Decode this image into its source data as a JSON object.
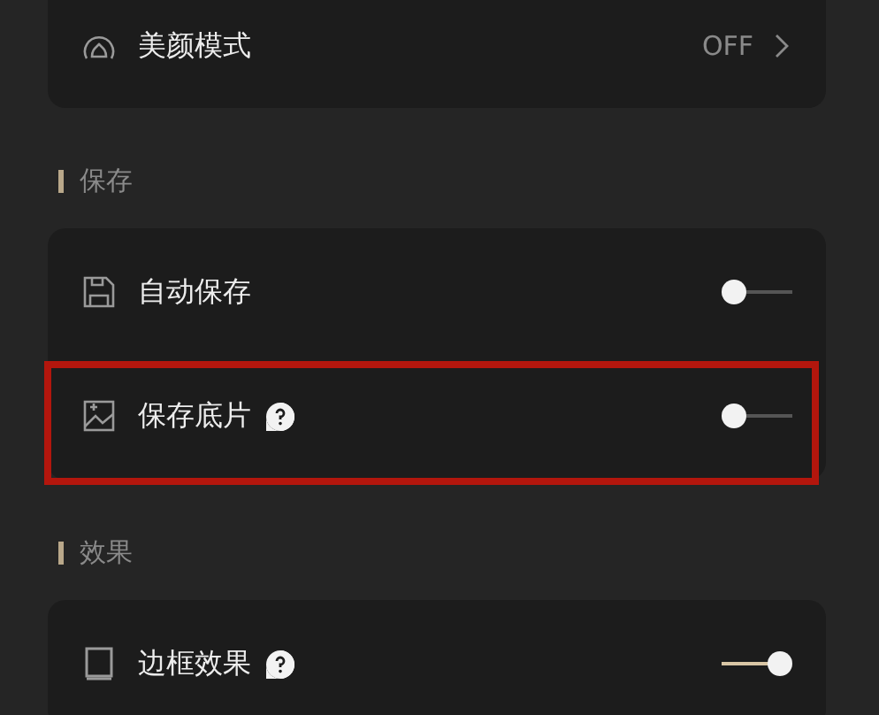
{
  "groups": [
    {
      "items": [
        {
          "kind": "link",
          "label": "美颜模式",
          "value": "OFF",
          "help": false,
          "highlighted": false
        }
      ]
    },
    {
      "header": "保存",
      "items": [
        {
          "kind": "toggle",
          "label": "自动保存",
          "on": false,
          "help": false,
          "highlighted": false
        },
        {
          "kind": "toggle",
          "label": "保存底片",
          "on": false,
          "help": true,
          "highlighted": true
        }
      ]
    },
    {
      "header": "效果",
      "items": [
        {
          "kind": "toggle",
          "label": "边框效果",
          "on": true,
          "help": true,
          "highlighted": false
        }
      ]
    }
  ]
}
